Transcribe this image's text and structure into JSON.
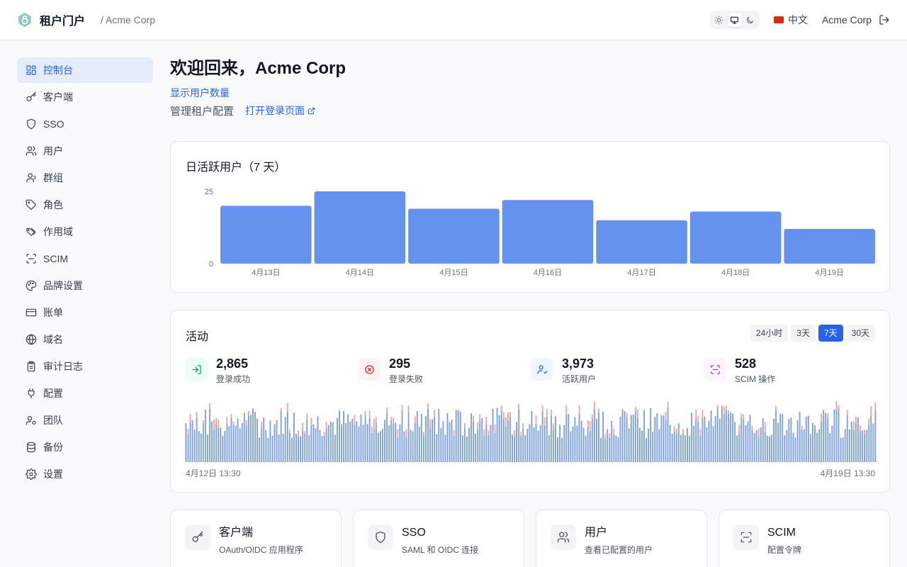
{
  "header": {
    "app_title": "租户门户",
    "tenant": "/ Acme Corp",
    "language": "中文",
    "user": "Acme Corp",
    "theme_options": [
      "light",
      "system",
      "dark"
    ],
    "theme_active": "system"
  },
  "sidebar": {
    "active": "控制台",
    "items": [
      {
        "label": "控制台",
        "icon": "dashboard-icon"
      },
      {
        "label": "客户端",
        "icon": "key-icon"
      },
      {
        "label": "SSO",
        "icon": "shield-icon"
      },
      {
        "label": "用户",
        "icon": "users-icon"
      },
      {
        "label": "群组",
        "icon": "group-icon"
      },
      {
        "label": "角色",
        "icon": "tag-icon"
      },
      {
        "label": "作用域",
        "icon": "tags-icon"
      },
      {
        "label": "SCIM",
        "icon": "scan-icon"
      },
      {
        "label": "品牌设置",
        "icon": "palette-icon"
      },
      {
        "label": "账单",
        "icon": "credit-card-icon"
      },
      {
        "label": "域名",
        "icon": "globe-icon"
      },
      {
        "label": "审计日志",
        "icon": "clipboard-icon"
      },
      {
        "label": "配置",
        "icon": "plug-icon"
      },
      {
        "label": "团队",
        "icon": "team-icon"
      },
      {
        "label": "备份",
        "icon": "database-icon"
      },
      {
        "label": "设置",
        "icon": "gear-icon"
      }
    ]
  },
  "main": {
    "welcome": "欢迎回来，Acme Corp",
    "show_users": "显示用户数量",
    "subtitle": "管理租户配置",
    "open_login": "打开登录页面"
  },
  "dau": {
    "title": "日活跃用户（7 天）"
  },
  "activity": {
    "title": "活动",
    "ranges": [
      "24小时",
      "3天",
      "7天",
      "30天"
    ],
    "active_range": "7天",
    "stats": [
      {
        "value": "2,865",
        "label": "登录成功",
        "icon": "login-icon",
        "color": "#16a34a",
        "bg": "#ecfdf5"
      },
      {
        "value": "295",
        "label": "登录失败",
        "icon": "x-circle-icon",
        "color": "#dc2626",
        "bg": "#fef2f2"
      },
      {
        "value": "3,973",
        "label": "活跃用户",
        "icon": "user-check-icon",
        "color": "#2563eb",
        "bg": "#eff6ff"
      },
      {
        "value": "528",
        "label": "SCIM 操作",
        "icon": "scan-icon",
        "color": "#c026d3",
        "bg": "#fdf4ff"
      }
    ],
    "start_label": "4月12日 13:30",
    "end_label": "4月19日 13:30",
    "success_color": "#7ba0dd",
    "failure_color": "#f2a3a3"
  },
  "features": [
    {
      "title": "客户端",
      "desc": "OAuth/OIDC 应用程序",
      "icon": "key-icon"
    },
    {
      "title": "SSO",
      "desc": "SAML 和 OIDC 连接",
      "icon": "shield-icon"
    },
    {
      "title": "用户",
      "desc": "查看已配置的用户",
      "icon": "users-icon"
    },
    {
      "title": "SCIM",
      "desc": "配置令牌",
      "icon": "scan-icon"
    }
  ],
  "chart_data": {
    "type": "bar",
    "title": "日活跃用户（7 天）",
    "categories": [
      "4月13日",
      "4月14日",
      "4月15日",
      "4月16日",
      "4月17日",
      "4月18日",
      "4月19日"
    ],
    "values": [
      20,
      25,
      19,
      22,
      15,
      18,
      12
    ],
    "ylim": [
      0,
      25
    ],
    "yticks": [
      0,
      25
    ],
    "color": "#6592ed",
    "grid": false
  }
}
